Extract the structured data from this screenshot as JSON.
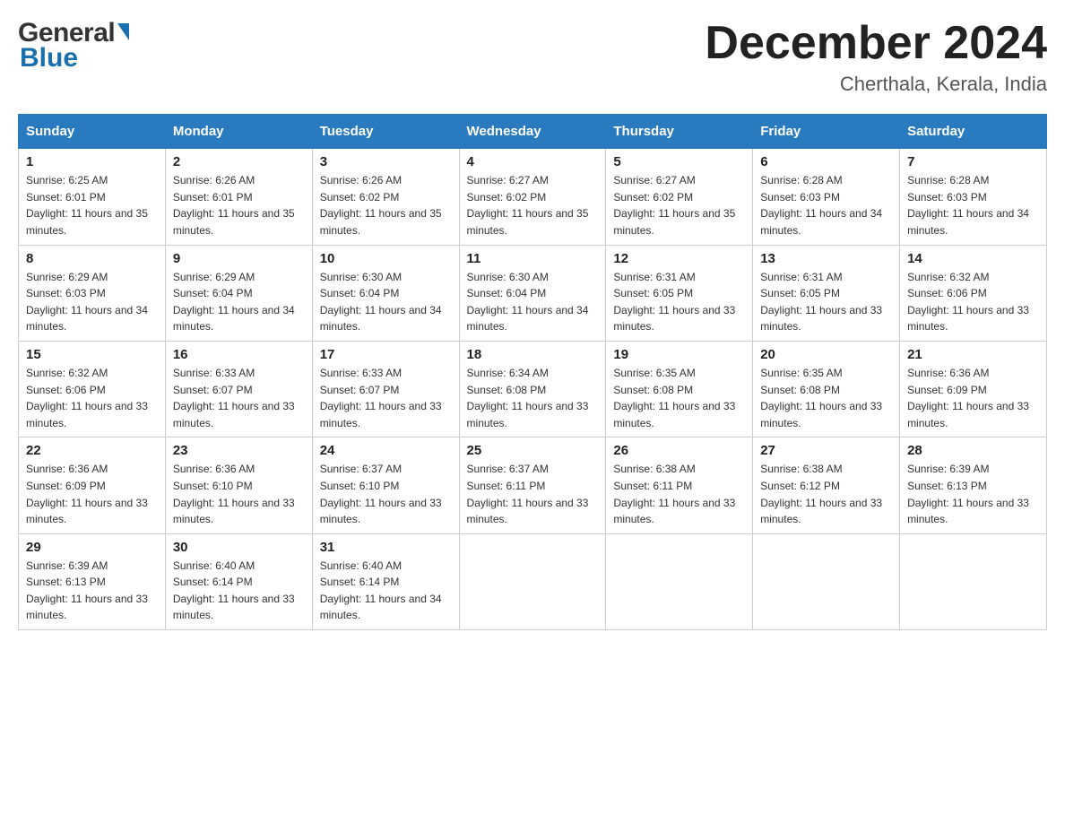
{
  "header": {
    "logo_general": "General",
    "logo_blue": "Blue",
    "month_title": "December 2024",
    "subtitle": "Cherthala, Kerala, India"
  },
  "weekdays": [
    "Sunday",
    "Monday",
    "Tuesday",
    "Wednesday",
    "Thursday",
    "Friday",
    "Saturday"
  ],
  "weeks": [
    [
      {
        "day": "1",
        "sunrise": "6:25 AM",
        "sunset": "6:01 PM",
        "daylight": "11 hours and 35 minutes."
      },
      {
        "day": "2",
        "sunrise": "6:26 AM",
        "sunset": "6:01 PM",
        "daylight": "11 hours and 35 minutes."
      },
      {
        "day": "3",
        "sunrise": "6:26 AM",
        "sunset": "6:02 PM",
        "daylight": "11 hours and 35 minutes."
      },
      {
        "day": "4",
        "sunrise": "6:27 AM",
        "sunset": "6:02 PM",
        "daylight": "11 hours and 35 minutes."
      },
      {
        "day": "5",
        "sunrise": "6:27 AM",
        "sunset": "6:02 PM",
        "daylight": "11 hours and 35 minutes."
      },
      {
        "day": "6",
        "sunrise": "6:28 AM",
        "sunset": "6:03 PM",
        "daylight": "11 hours and 34 minutes."
      },
      {
        "day": "7",
        "sunrise": "6:28 AM",
        "sunset": "6:03 PM",
        "daylight": "11 hours and 34 minutes."
      }
    ],
    [
      {
        "day": "8",
        "sunrise": "6:29 AM",
        "sunset": "6:03 PM",
        "daylight": "11 hours and 34 minutes."
      },
      {
        "day": "9",
        "sunrise": "6:29 AM",
        "sunset": "6:04 PM",
        "daylight": "11 hours and 34 minutes."
      },
      {
        "day": "10",
        "sunrise": "6:30 AM",
        "sunset": "6:04 PM",
        "daylight": "11 hours and 34 minutes."
      },
      {
        "day": "11",
        "sunrise": "6:30 AM",
        "sunset": "6:04 PM",
        "daylight": "11 hours and 34 minutes."
      },
      {
        "day": "12",
        "sunrise": "6:31 AM",
        "sunset": "6:05 PM",
        "daylight": "11 hours and 33 minutes."
      },
      {
        "day": "13",
        "sunrise": "6:31 AM",
        "sunset": "6:05 PM",
        "daylight": "11 hours and 33 minutes."
      },
      {
        "day": "14",
        "sunrise": "6:32 AM",
        "sunset": "6:06 PM",
        "daylight": "11 hours and 33 minutes."
      }
    ],
    [
      {
        "day": "15",
        "sunrise": "6:32 AM",
        "sunset": "6:06 PM",
        "daylight": "11 hours and 33 minutes."
      },
      {
        "day": "16",
        "sunrise": "6:33 AM",
        "sunset": "6:07 PM",
        "daylight": "11 hours and 33 minutes."
      },
      {
        "day": "17",
        "sunrise": "6:33 AM",
        "sunset": "6:07 PM",
        "daylight": "11 hours and 33 minutes."
      },
      {
        "day": "18",
        "sunrise": "6:34 AM",
        "sunset": "6:08 PM",
        "daylight": "11 hours and 33 minutes."
      },
      {
        "day": "19",
        "sunrise": "6:35 AM",
        "sunset": "6:08 PM",
        "daylight": "11 hours and 33 minutes."
      },
      {
        "day": "20",
        "sunrise": "6:35 AM",
        "sunset": "6:08 PM",
        "daylight": "11 hours and 33 minutes."
      },
      {
        "day": "21",
        "sunrise": "6:36 AM",
        "sunset": "6:09 PM",
        "daylight": "11 hours and 33 minutes."
      }
    ],
    [
      {
        "day": "22",
        "sunrise": "6:36 AM",
        "sunset": "6:09 PM",
        "daylight": "11 hours and 33 minutes."
      },
      {
        "day": "23",
        "sunrise": "6:36 AM",
        "sunset": "6:10 PM",
        "daylight": "11 hours and 33 minutes."
      },
      {
        "day": "24",
        "sunrise": "6:37 AM",
        "sunset": "6:10 PM",
        "daylight": "11 hours and 33 minutes."
      },
      {
        "day": "25",
        "sunrise": "6:37 AM",
        "sunset": "6:11 PM",
        "daylight": "11 hours and 33 minutes."
      },
      {
        "day": "26",
        "sunrise": "6:38 AM",
        "sunset": "6:11 PM",
        "daylight": "11 hours and 33 minutes."
      },
      {
        "day": "27",
        "sunrise": "6:38 AM",
        "sunset": "6:12 PM",
        "daylight": "11 hours and 33 minutes."
      },
      {
        "day": "28",
        "sunrise": "6:39 AM",
        "sunset": "6:13 PM",
        "daylight": "11 hours and 33 minutes."
      }
    ],
    [
      {
        "day": "29",
        "sunrise": "6:39 AM",
        "sunset": "6:13 PM",
        "daylight": "11 hours and 33 minutes."
      },
      {
        "day": "30",
        "sunrise": "6:40 AM",
        "sunset": "6:14 PM",
        "daylight": "11 hours and 33 minutes."
      },
      {
        "day": "31",
        "sunrise": "6:40 AM",
        "sunset": "6:14 PM",
        "daylight": "11 hours and 34 minutes."
      },
      null,
      null,
      null,
      null
    ]
  ]
}
